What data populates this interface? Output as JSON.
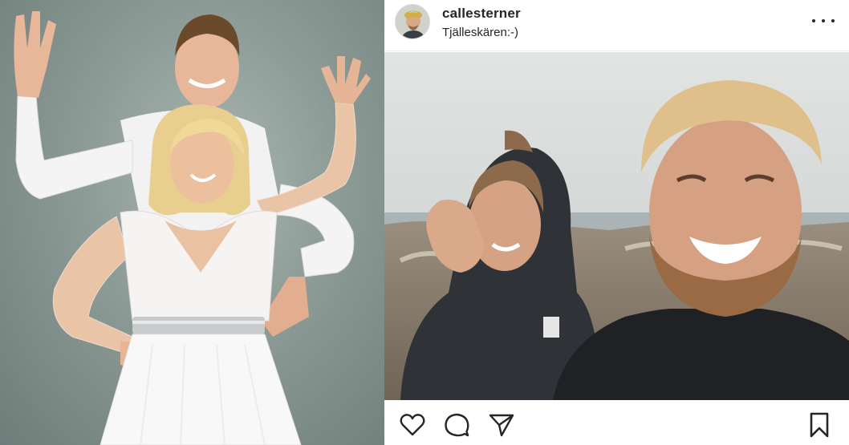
{
  "post": {
    "username": "callesterner",
    "location": "Tjälleskären:-)",
    "actions": {
      "like_icon": "heart-outline-icon",
      "comment_icon": "comment-bubble-icon",
      "share_icon": "paper-plane-icon",
      "save_icon": "bookmark-outline-icon",
      "more_icon": "more-options-icon"
    }
  },
  "colors": {
    "text": "#262626",
    "divider": "#ececec",
    "studio_background": "#8c9a96"
  }
}
